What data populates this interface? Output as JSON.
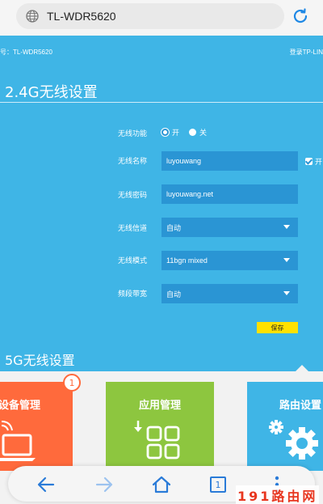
{
  "browser": {
    "url": "TL-WDR5620",
    "globe_icon": "globe-icon",
    "reload_icon": "reload-icon"
  },
  "router": {
    "model_label": "号：TL-WDR5620",
    "login_label": "登录TP-LIN",
    "section_24g_title": "2.4G无线设置",
    "rows": {
      "wireless_function": {
        "label": "无线功能",
        "on": "开",
        "off": "关",
        "selected": "开"
      },
      "ssid": {
        "label": "无线名称",
        "value": "luyouwang"
      },
      "password": {
        "label": "无线密码",
        "value": "luyouwang.net"
      },
      "channel": {
        "label": "无线信道",
        "value": "自动"
      },
      "mode": {
        "label": "无线模式",
        "value": "11bgn mixed"
      },
      "bandwidth": {
        "label": "频段带宽",
        "value": "自动"
      }
    },
    "broadcast_label": "开",
    "save_label": "保存",
    "section_5g_title": "5G无线设置",
    "accent_color": "#3fb5e6",
    "field_color": "#2a95d4",
    "save_color": "#ffe100"
  },
  "dock": {
    "device_title": "设备管理",
    "device_badge": "1",
    "apps_title": "应用管理",
    "router_title": "路由设置",
    "device_color": "#ff6a3c",
    "apps_color": "#8dc63f"
  },
  "nav": {
    "back_icon": "back-arrow-icon",
    "forward_icon": "forward-arrow-icon",
    "home_icon": "home-icon",
    "tabs_count": "1",
    "menu_icon": "more-dots-icon"
  },
  "watermark": "191路由网"
}
